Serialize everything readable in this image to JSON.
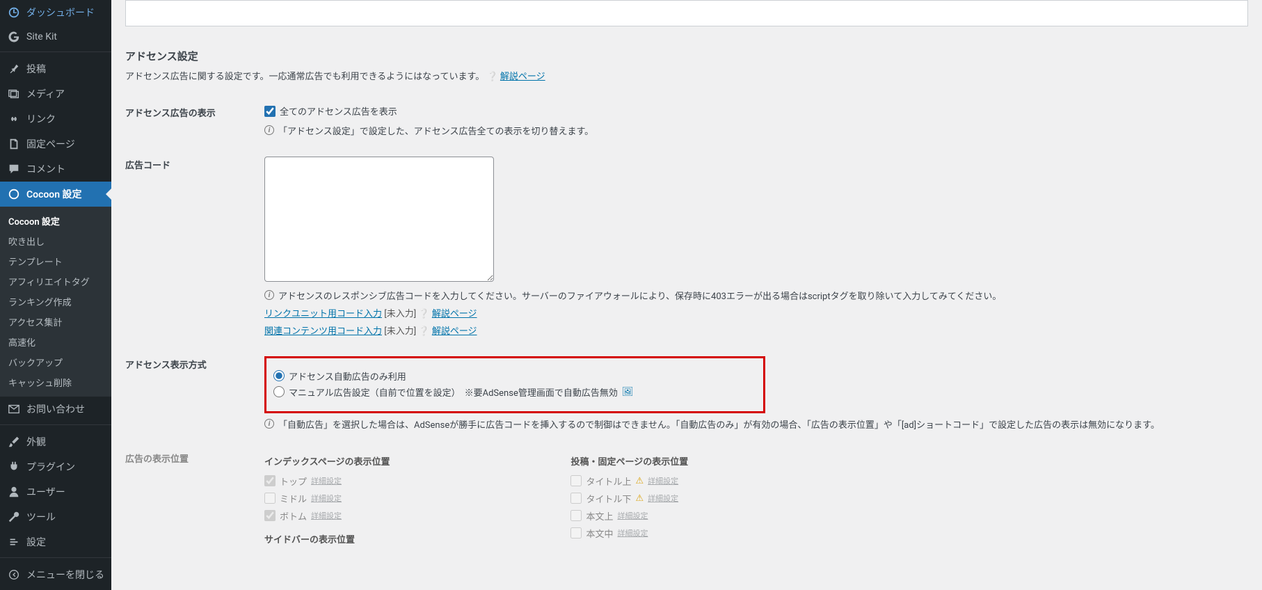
{
  "sidebar": {
    "dashboard": "ダッシュボード",
    "sitekit": "Site Kit",
    "posts": "投稿",
    "media": "メディア",
    "links": "リンク",
    "pages": "固定ページ",
    "comments": "コメント",
    "cocoon": "Cocoon 設定",
    "submenu": {
      "cocoon_settings": "Cocoon 設定",
      "speech_balloon": "吹き出し",
      "template": "テンプレート",
      "affiliate_tag": "アフィリエイトタグ",
      "ranking": "ランキング作成",
      "access": "アクセス集計",
      "speedup": "高速化",
      "backup": "バックアップ",
      "cache_delete": "キャッシュ削除"
    },
    "contact": "お問い合わせ",
    "appearance": "外観",
    "plugins": "プラグイン",
    "users": "ユーザー",
    "tools": "ツール",
    "settings": "設定",
    "collapse": "メニューを閉じる"
  },
  "section": {
    "title": "アドセンス設定",
    "desc": "アドセンス広告に関する設定です。一応通常広告でも利用できるようにはなっています。",
    "desc_link": "解説ページ"
  },
  "row_display": {
    "label": "アドセンス広告の表示",
    "checkbox": "全てのアドセンス広告を表示",
    "info": "「アドセンス設定」で設定した、アドセンス広告全ての表示を切り替えます。"
  },
  "row_code": {
    "label": "広告コード",
    "value": "",
    "info": "アドセンスのレスポンシブ広告コードを入力してください。サーバーのファイアウォールにより、保存時に403エラーが出る場合はscriptタグを取り除いて入力してみてください。",
    "link_unit": "リンクユニット用コード入力",
    "related": "関連コンテンツ用コード入力",
    "status": "[未入力]",
    "help": "解説ページ"
  },
  "row_method": {
    "label": "アドセンス表示方式",
    "r1": "アドセンス自動広告のみ利用",
    "r2a": "マニュアル広告設定（自前で位置を設定）",
    "r2b": "※要AdSense管理画面で自動広告無効",
    "info": "「自動広告」を選択した場合は、AdSenseが勝手に広告コードを挿入するので制御はできません。「自動広告のみ」が有効の場合、「広告の表示位置」や「[ad]ショートコード」で設定した広告の表示は無効になります。"
  },
  "row_positions": {
    "label": "広告の表示位置",
    "index_title": "インデックスページの表示位置",
    "index_top": "トップ",
    "index_middle": "ミドル",
    "index_bottom": "ボトム",
    "sidebar_title": "サイドバーの表示位置",
    "post_title": "投稿・固定ページの表示位置",
    "post_title_above": "タイトル上",
    "post_title_below": "タイトル下",
    "post_body_above": "本文上",
    "post_body_middle": "本文中",
    "detail": "詳細設定"
  }
}
